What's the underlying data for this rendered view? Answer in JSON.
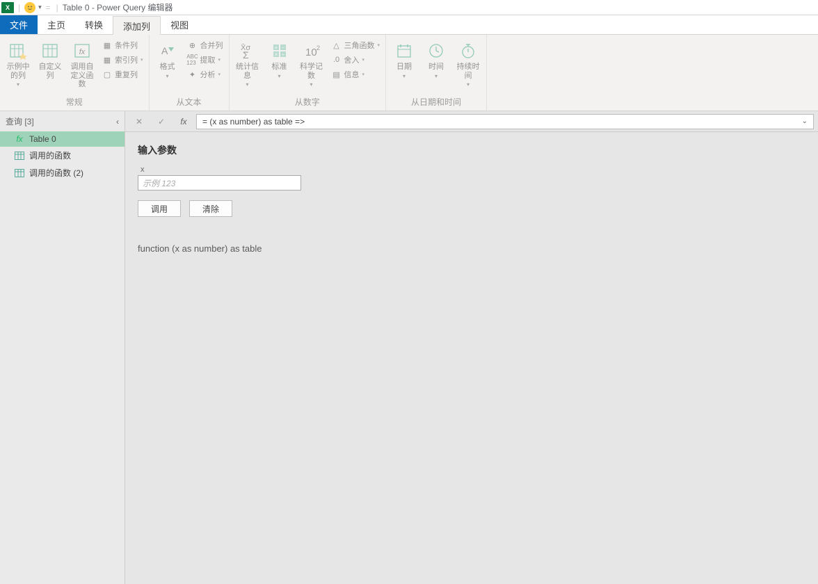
{
  "titlebar": {
    "excel_badge": "X",
    "qat_arrow": "▾",
    "sep": "=",
    "title": "Table 0 - Power Query 编辑器"
  },
  "tabs": {
    "file": "文件",
    "home": "主页",
    "transform": "转换",
    "addcol": "添加列",
    "view": "视图"
  },
  "ribbon": {
    "general": {
      "label": "常规",
      "example": "示例中的列",
      "custom": "自定义列",
      "invoke": "调用自定义函数",
      "cond": "条件列",
      "index": "索引列",
      "dup": "重复列"
    },
    "text": {
      "label": "从文本",
      "format": "格式",
      "merge": "合并列",
      "extract": "提取",
      "parse": "分析"
    },
    "number": {
      "label": "从数字",
      "stats": "统计信息",
      "standard": "标准",
      "sci": "科学记数",
      "trig": "三角函数",
      "round": "舍入",
      "info": "信息"
    },
    "datetime": {
      "label": "从日期和时间",
      "date": "日期",
      "time": "时间",
      "duration": "持续时间"
    }
  },
  "side": {
    "header": "查询 [3]",
    "collapse": "‹",
    "items": [
      {
        "kind": "fx",
        "label": "Table 0"
      },
      {
        "kind": "table",
        "label": "调用的函数"
      },
      {
        "kind": "table",
        "label": "调用的函数 (2)"
      }
    ]
  },
  "formula": {
    "cancel": "✕",
    "confirm": "✓",
    "fx": "fx",
    "text": "= (x as number) as table =>",
    "expand": "⌄"
  },
  "content": {
    "heading": "输入参数",
    "param_name": "x",
    "placeholder": "示例 123",
    "invoke_btn": "调用",
    "clear_btn": "清除",
    "signature": "function (x as number) as table"
  }
}
